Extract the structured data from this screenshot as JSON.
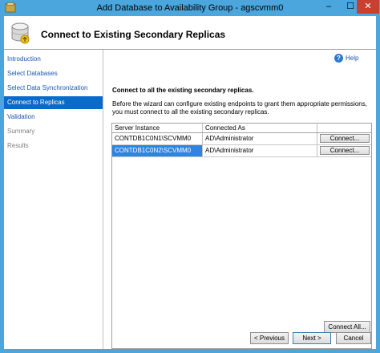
{
  "window": {
    "title": "Add Database to Availability Group - agscvmm0",
    "controls": {
      "minimize": "–",
      "maximize": "☐",
      "close": "✕"
    }
  },
  "header": {
    "title": "Connect to Existing Secondary Replicas"
  },
  "nav": {
    "items": [
      {
        "label": "Introduction",
        "state": "link"
      },
      {
        "label": "Select Databases",
        "state": "link"
      },
      {
        "label": "Select Data Synchronization",
        "state": "link"
      },
      {
        "label": "Connect to Replicas",
        "state": "active"
      },
      {
        "label": "Validation",
        "state": "link"
      },
      {
        "label": "Summary",
        "state": "disabled"
      },
      {
        "label": "Results",
        "state": "disabled"
      }
    ]
  },
  "main": {
    "help_label": "Help",
    "section_title": "Connect to all the existing secondary replicas.",
    "description": "Before the wizard can configure existing endpoints to grant them appropriate permissions, you must connect to all the existing secondary replicas.",
    "grid": {
      "columns": [
        "Server Instance",
        "Connected As",
        ""
      ],
      "rows": [
        {
          "server": "CONTDB1C0N1\\SCVMM0",
          "connected_as": "AD\\Administrator",
          "action": "Connect...",
          "selected": false
        },
        {
          "server": "CONTDB1C0N2\\SCVMM0",
          "connected_as": "AD\\Administrator",
          "action": "Connect...",
          "selected": true
        }
      ]
    },
    "connect_all_label": "Connect All...",
    "footer": {
      "previous": "< Previous",
      "next": "Next >",
      "cancel": "Cancel"
    }
  },
  "colors": {
    "titlebar": "#4aa6dd",
    "nav_active": "#0a6ac9",
    "link": "#1a56b4",
    "selection": "#2f84e0"
  }
}
